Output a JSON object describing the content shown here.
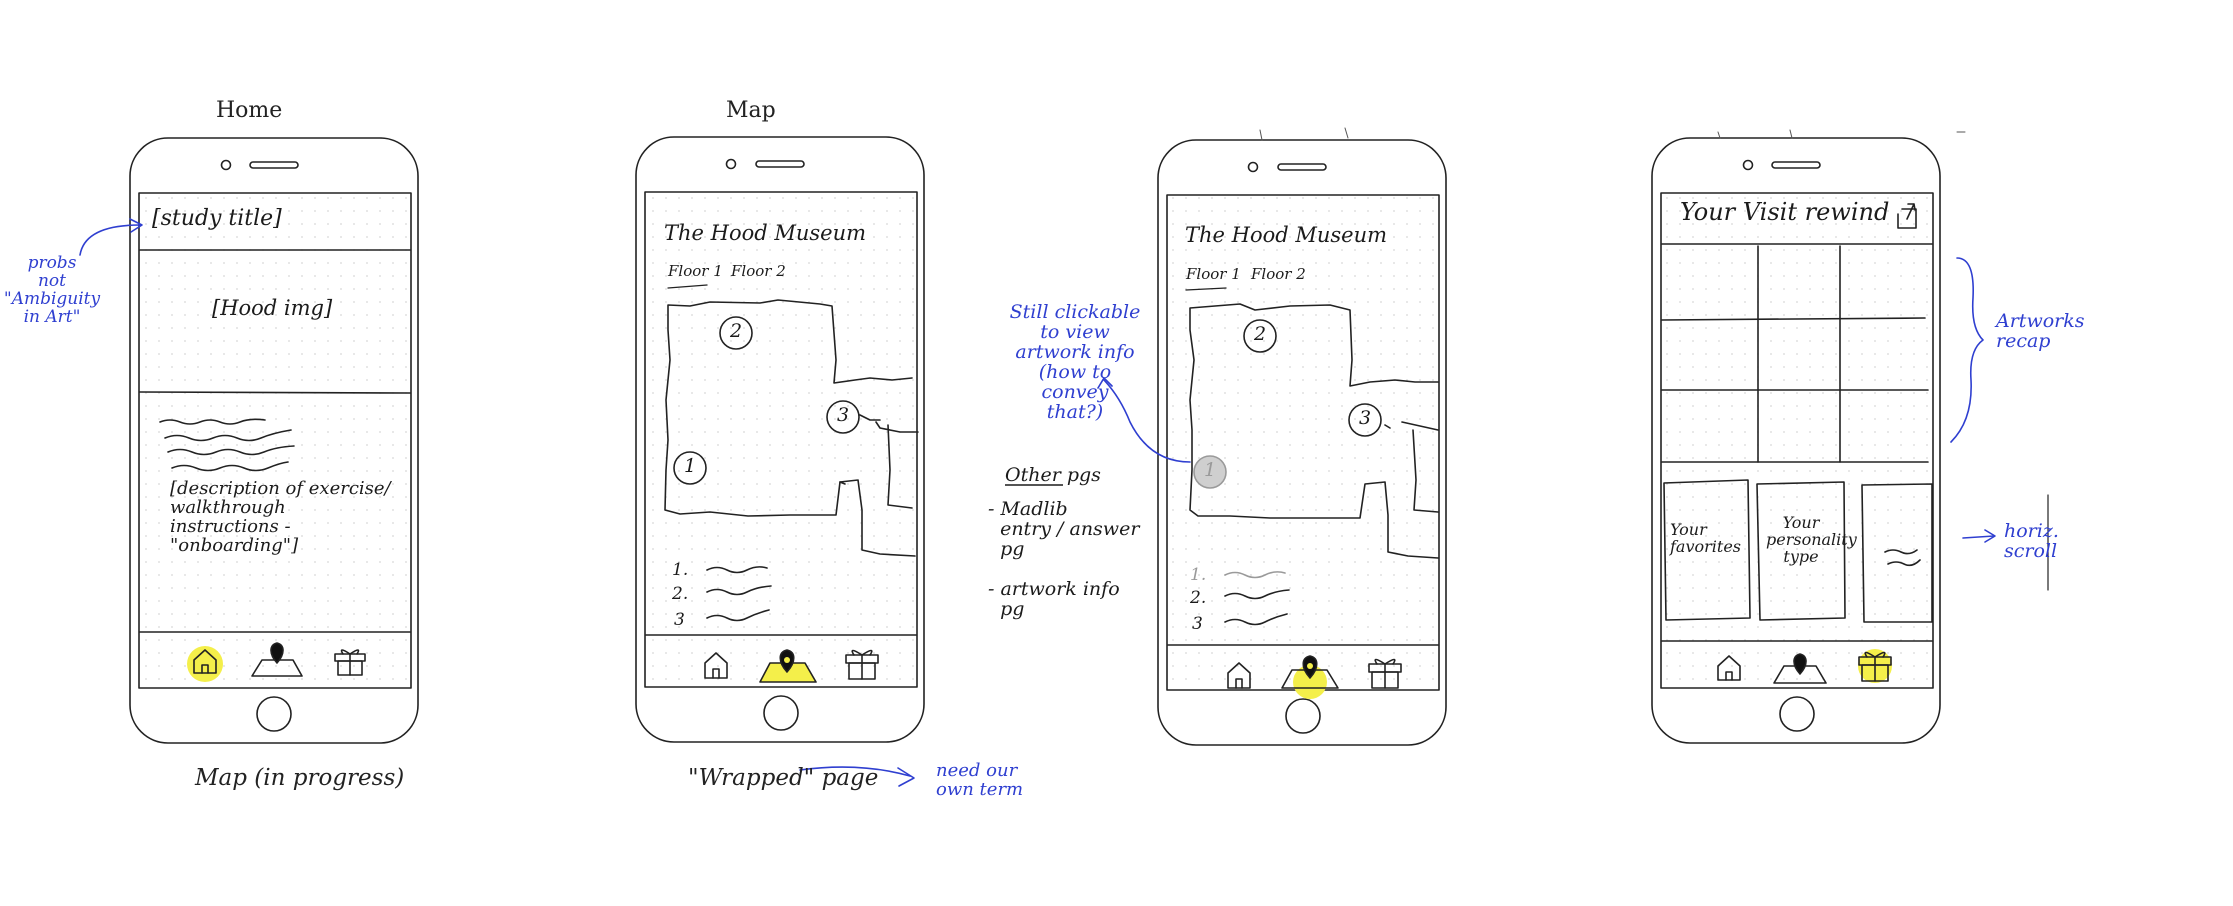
{
  "frame_labels": {
    "home": "Home",
    "map": "Map",
    "map_in_progress": "Map (in progress)",
    "wrapped_page": "\"Wrapped\" page"
  },
  "phone1": {
    "study_title": "[study title]",
    "hood_img": "[Hood img]",
    "description": "[description of exercise/\nwalkthrough\ninstructions -\n\"onboarding\"]"
  },
  "phone2": {
    "museum_title": "The Hood Museum",
    "floor1_tab": "Floor 1",
    "floor2_tab": "Floor 2",
    "stops": [
      "1",
      "2",
      "3"
    ],
    "list_numbers": [
      "1.",
      "2.",
      "3"
    ]
  },
  "phone3": {
    "museum_title": "The Hood Museum",
    "floor1_tab": "Floor 1",
    "floor2_tab": "Floor 2",
    "stops": [
      "1",
      "2",
      "3"
    ],
    "list_numbers": [
      "1.",
      "2.",
      "3"
    ]
  },
  "phone4": {
    "visit_title": "Your Visit rewind",
    "card_favorites": "Your\nfavorites",
    "card_personality": "Your\npersonality\ntype"
  },
  "annotations": {
    "probs_not": "probs\nnot\n\"Ambiguity\nin Art\"",
    "still_clickable": "Still clickable\nto view\nartwork info\n(how to\nconvey\nthat?)",
    "other_pgs_heading": "Other pgs",
    "other_pgs_items": "- Madlib\n  entry / answer\n  pg\n\n- artwork info\n  pg",
    "need_own_term": "need our\nown term",
    "artworks_recap": "Artworks\nrecap",
    "horiz_scroll": "horiz.\nscroll"
  },
  "colors": {
    "ink": "#1b1b1b",
    "annotation_blue": "#2f3fd0",
    "highlight_yellow": "#f4ef4a",
    "muted_gray": "#9a9a9a"
  },
  "icons": [
    "home-icon",
    "map-pin-icon",
    "gift-icon",
    "share-icon",
    "phone-camera-icon",
    "phone-speaker-icon",
    "phone-home-button-icon"
  ]
}
